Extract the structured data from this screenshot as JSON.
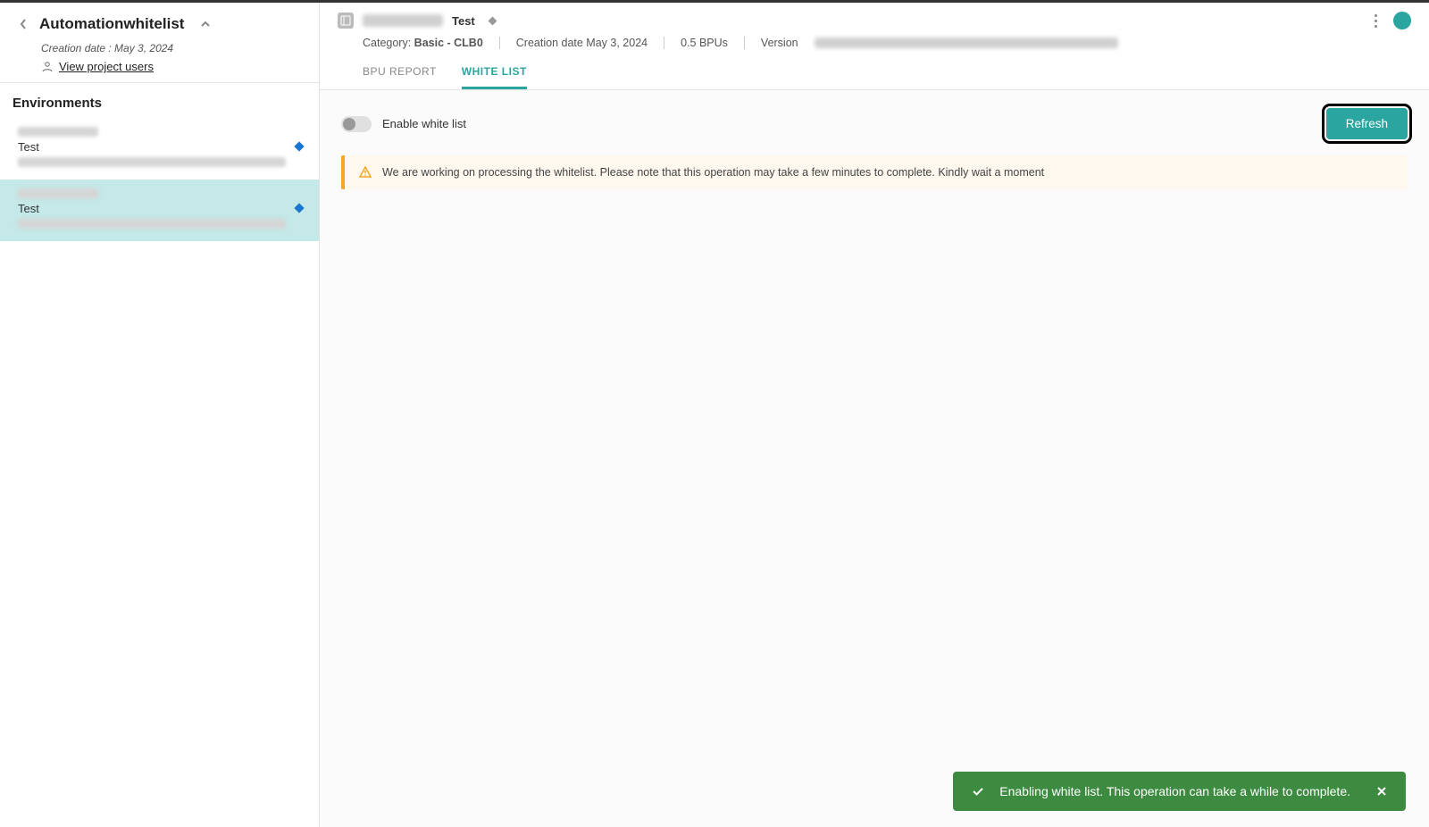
{
  "sidebar": {
    "project_title": "Automationwhitelist",
    "creation_date_label": "Creation date : May 3, 2024",
    "view_users": "View project users",
    "env_section_title": "Environments",
    "items": [
      {
        "type": "Test"
      },
      {
        "type": "Test"
      }
    ]
  },
  "header": {
    "badge": "Test",
    "meta": {
      "category_label": "Category: ",
      "category_value": "Basic - CLB0",
      "creation_date": "Creation date May 3, 2024",
      "bpus": "0.5 BPUs",
      "version_label": "Version"
    }
  },
  "tabs": {
    "bpu_report": "BPU REPORT",
    "white_list": "WHITE LIST"
  },
  "whitelist": {
    "toggle_label": "Enable white list",
    "refresh": "Refresh",
    "alert": "We are working on processing the whitelist. Please note that this operation may take a few minutes to complete. Kindly wait a moment"
  },
  "toast": {
    "message": "Enabling white list. This operation can take a while to complete."
  }
}
